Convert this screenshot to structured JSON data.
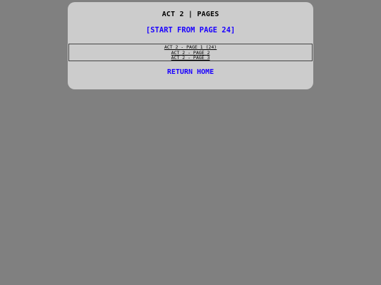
{
  "panel": {
    "title": "ACT 2 | PAGES",
    "start_link": "[START FROM PAGE 24]",
    "pages": [
      {
        "label": "ACT 2 - PAGE 1 (24)"
      },
      {
        "label": "ACT 2 - PAGE 2"
      },
      {
        "label": "ACT 2 - PAGE 3"
      }
    ],
    "return_link": "RETURN HOME"
  },
  "colors": {
    "background": "#808080",
    "panel": "#cccccc",
    "link": "#1a00ff",
    "text": "#000000"
  }
}
